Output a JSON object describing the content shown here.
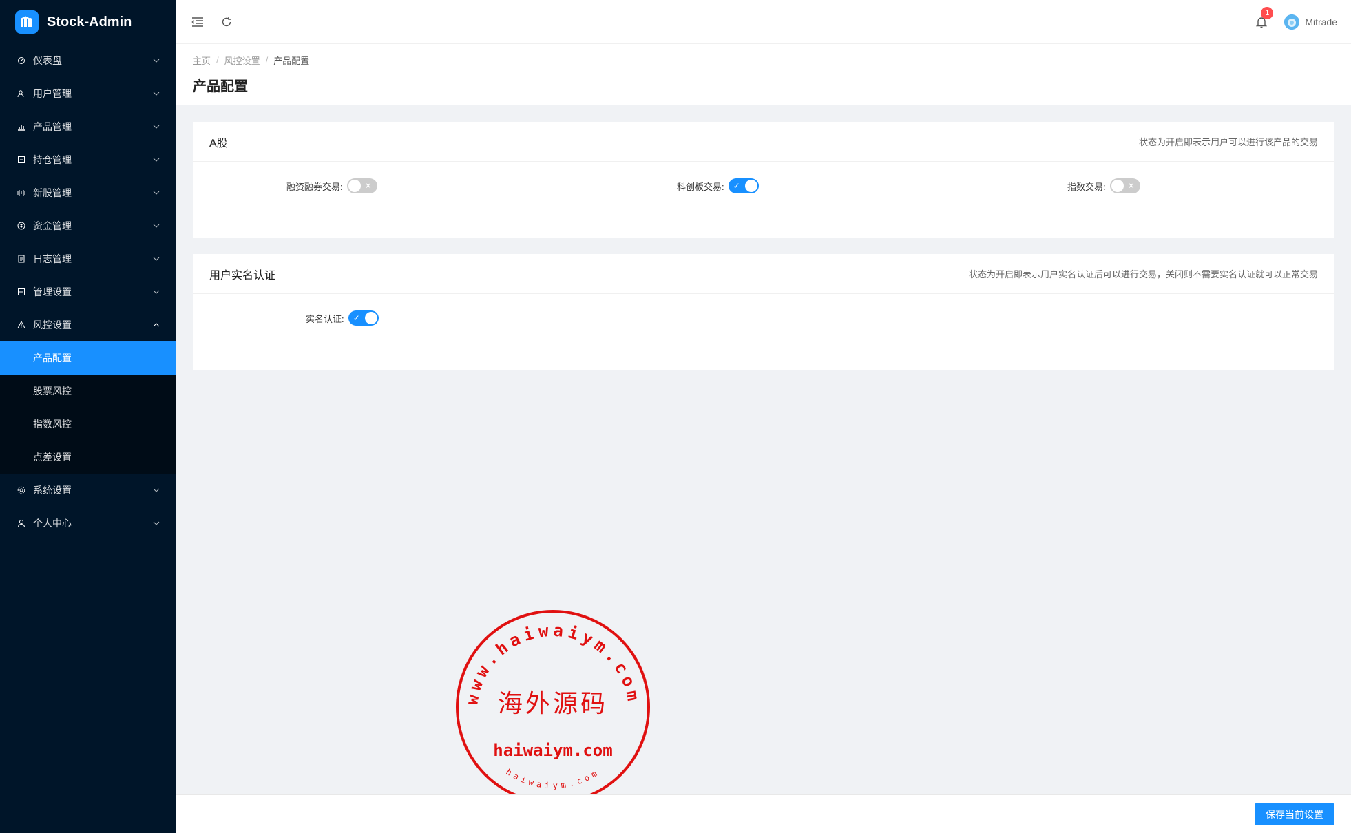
{
  "app": {
    "title": "Stock-Admin"
  },
  "sidebar": {
    "items": [
      {
        "label": "仪表盘",
        "icon": "dashboard-icon"
      },
      {
        "label": "用户管理",
        "icon": "users-icon"
      },
      {
        "label": "产品管理",
        "icon": "chart-icon"
      },
      {
        "label": "持仓管理",
        "icon": "holdings-icon"
      },
      {
        "label": "新股管理",
        "icon": "new-stock-icon"
      },
      {
        "label": "资金管理",
        "icon": "money-icon"
      },
      {
        "label": "日志管理",
        "icon": "log-icon"
      },
      {
        "label": "管理设置",
        "icon": "admin-settings-icon"
      },
      {
        "label": "风控设置",
        "icon": "warning-icon"
      },
      {
        "label": "系统设置",
        "icon": "gear-icon"
      },
      {
        "label": "个人中心",
        "icon": "user-icon"
      }
    ],
    "risk_submenu": [
      {
        "label": "产品配置",
        "active": true
      },
      {
        "label": "股票风控",
        "active": false
      },
      {
        "label": "指数风控",
        "active": false
      },
      {
        "label": "点差设置",
        "active": false
      }
    ]
  },
  "header": {
    "notification_count": "1",
    "username": "Mitrade"
  },
  "breadcrumb": [
    "主页",
    "风控设置",
    "产品配置"
  ],
  "page_title": "产品配置",
  "cards": {
    "a_shares": {
      "title": "A股",
      "hint": "状态为开启即表示用户可以进行该产品的交易",
      "fields": [
        {
          "label": "融资融券交易:",
          "on": false
        },
        {
          "label": "科创板交易:",
          "on": true
        },
        {
          "label": "指数交易:",
          "on": false
        }
      ]
    },
    "realname": {
      "title": "用户实名认证",
      "hint": "状态为开启即表示用户实名认证后可以进行交易，关闭则不需要实名认证就可以正常交易",
      "fields": [
        {
          "label": "实名认证:",
          "on": true
        }
      ]
    }
  },
  "footer": {
    "save_label": "保存当前设置"
  },
  "watermark": {
    "ring_text": "www.haiwaiym.com",
    "center_text": "海外源码",
    "domain_text": "haiwaiym.com",
    "bottom_text": "haiwaiym.com"
  },
  "colors": {
    "sidebar_bg": "#001529",
    "primary": "#1890ff",
    "stamp": "#e01010"
  }
}
